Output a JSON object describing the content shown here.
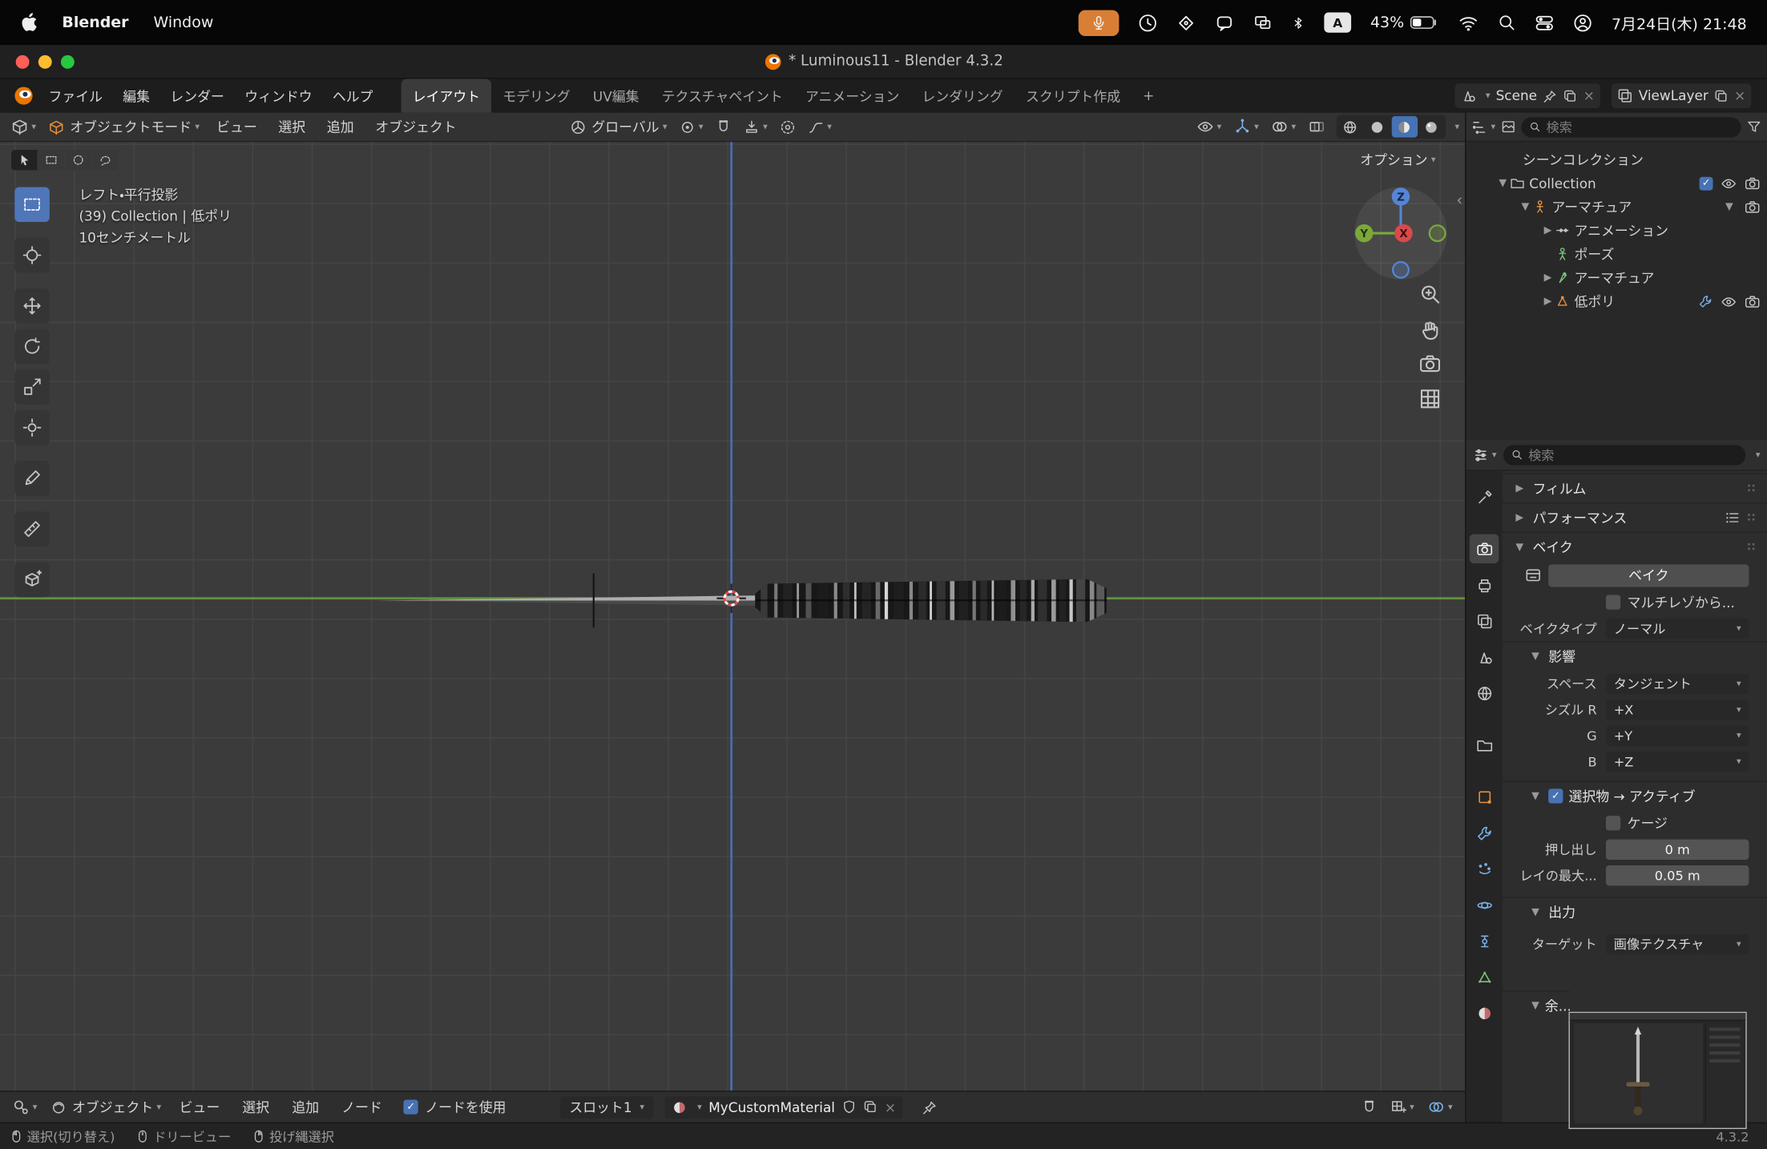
{
  "macos": {
    "app_name": "Blender",
    "window_menu": "Window",
    "battery": "43%",
    "input_source": "A",
    "datetime": "7月24日(木) 21:48"
  },
  "window": {
    "title": "* Luminous11 - Blender 4.3.2"
  },
  "topbar": {
    "menus": [
      "ファイル",
      "編集",
      "レンダー",
      "ウィンドウ",
      "ヘルプ"
    ],
    "workspaces": [
      "レイアウト",
      "モデリング",
      "UV編集",
      "テクスチャペイント",
      "アニメーション",
      "レンダリング",
      "スクリプト作成"
    ],
    "add_tab": "+",
    "scene_name": "Scene",
    "view_layer_name": "ViewLayer"
  },
  "viewport_header": {
    "mode": "オブジェクトモード",
    "menus": [
      "ビュー",
      "選択",
      "追加",
      "オブジェクト"
    ],
    "orientation": "グローバル"
  },
  "viewport": {
    "options_label": "オプション",
    "overlay_lines": [
      "レフト・平行投影",
      "(39) Collection | 低ポリ",
      "10センチメートル"
    ],
    "gizmo_axes": {
      "x": "X",
      "y": "Y",
      "z": "Z"
    }
  },
  "outliner": {
    "search_placeholder": "検索",
    "rows": [
      {
        "label": "シーンコレクション"
      },
      {
        "label": "Collection"
      },
      {
        "label": "アーマチュア"
      },
      {
        "label": "アニメーション"
      },
      {
        "label": "ポーズ"
      },
      {
        "label": "アーマチュア"
      },
      {
        "label": "低ポリ"
      }
    ]
  },
  "properties": {
    "search_placeholder": "検索",
    "film_panel": "フィルム",
    "performance_panel": "パフォーマンス",
    "bake_panel": "ベイク",
    "bake_button": "ベイク",
    "multires_label": "マルチレゾから...",
    "bake_type_label": "ベイクタイプ",
    "bake_type_value": "ノーマル",
    "influence_panel": "影響",
    "space_label": "スペース",
    "space_value": "タンジェント",
    "swizzle_r_label": "シズル R",
    "swizzle_r_value": "+X",
    "swizzle_g_label": "G",
    "swizzle_g_value": "+Y",
    "swizzle_b_label": "B",
    "swizzle_b_value": "+Z",
    "selected_to_active_panel": "選択物 → アクティブ",
    "cage_label": "ケージ",
    "extrusion_label": "押し出し",
    "extrusion_value": "0 m",
    "max_ray_label": "レイの最大...",
    "max_ray_value": "0.05 m",
    "output_panel": "出力",
    "target_label": "ターゲット",
    "target_value": "画像テクスチャ",
    "margin_panel": "余..."
  },
  "shader_editor": {
    "object_mode": "オブジェクト",
    "menus": [
      "ビュー",
      "選択",
      "追加",
      "ノード"
    ],
    "use_nodes_label": "ノードを使用",
    "slot_label": "スロット1",
    "material_name": "MyCustomMaterial"
  },
  "statusbar": {
    "hints": [
      "選択(切り替え)",
      "ドリービュー",
      "投げ縄選択"
    ],
    "version": "4.3.2"
  },
  "colors": {
    "accent_blue": "#4772b3",
    "axis_green": "#69A33C",
    "axis_blue": "#4F74C2",
    "axis_red": "#D84A4A",
    "armature_orange": "#E8913C"
  }
}
